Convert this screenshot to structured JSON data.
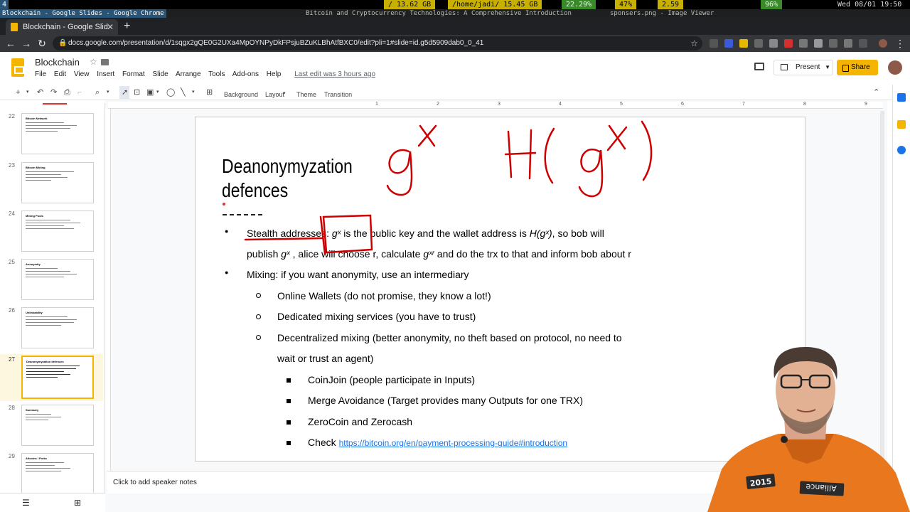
{
  "statusbar": {
    "workspaces": [
      "1",
      "4"
    ],
    "segments": [
      {
        "text": "/ 13.62 GB",
        "style": "yellow"
      },
      {
        "text": "/home/jadi/ 15.45 GB",
        "style": "yellow"
      },
      {
        "text": "22.29%",
        "style": "green"
      },
      {
        "text": "47%",
        "style": "yellow"
      },
      {
        "text": "2.59",
        "style": "yellow"
      },
      {
        "text": "30%",
        "style": "plain"
      },
      {
        "text": "96%",
        "style": "green"
      },
      {
        "text": "Wed 08/01 19:50",
        "style": "plain"
      }
    ]
  },
  "windowbar": {
    "focused": "Blockchain - Google Slides - Google Chrome",
    "other1": "Bitcoin and Cryptocurrency Technologies: A Comprehensive Introduction",
    "other2": "sponsers.png - Image Viewer"
  },
  "browser": {
    "tab_title": "Blockchain - Google Slid",
    "url": "docs.google.com/presentation/d/1sqgx2gQE0G2UXa4MpOYNPyDkFPsjuBZuKLBhAtfBXC0/edit?pli=1#slide=id.g5d5909dab0_0_41",
    "icons": {
      "back": "arrow-left-icon",
      "forward": "arrow-right-icon",
      "reload": "reload-icon",
      "star": "star-icon"
    }
  },
  "app": {
    "title": "Blockchain",
    "menus": [
      "File",
      "Edit",
      "View",
      "Insert",
      "Format",
      "Slide",
      "Arrange",
      "Tools",
      "Add-ons",
      "Help"
    ],
    "last_edit": "Last edit was 3 hours ago",
    "present_label": "Present",
    "share_label": "Share"
  },
  "toolbar": {
    "background_label": "Background",
    "layout_label": "Layout",
    "theme_label": "Theme",
    "transition_label": "Transition"
  },
  "ruler": [
    "1",
    "2",
    "3",
    "4",
    "5",
    "6",
    "7",
    "8",
    "9"
  ],
  "filmstrip": {
    "slides": [
      {
        "num": "22",
        "title": "Bitcoin Network"
      },
      {
        "num": "23",
        "title": "Bitcoin Mining"
      },
      {
        "num": "24",
        "title": "Mining Pools"
      },
      {
        "num": "25",
        "title": "Anonymity"
      },
      {
        "num": "26",
        "title": "Unlinkability"
      },
      {
        "num": "27",
        "title": "Deanonymyzation defences"
      },
      {
        "num": "28",
        "title": "Summary"
      },
      {
        "num": "29",
        "title": "Altcoins / Forks"
      }
    ],
    "selected": "27"
  },
  "slide": {
    "title_line1": "Deanonymyzation",
    "title_line2": "defences",
    "bullet1_part1": "Stealth addresses:",
    "bullet1_gx": "gˣ",
    "bullet1_part2": "is the public key and the wallet address is",
    "bullet1_hgx": "H(gˣ)",
    "bullet1_part3": ", so bob will",
    "bullet1_line2_a": "publish",
    "bullet1_line2_gx": "gˣ",
    "bullet1_line2_b": ", alice will choose r, calculate",
    "bullet1_line2_gxr": "gˣʳ",
    "bullet1_line2_c": "and do the trx to that and inform bob about r",
    "bullet2": "Mixing: if you want anonymity, use an intermediary",
    "sub1": "Online Wallets (do not promise, they know a lot!)",
    "sub2": "Dedicated mixing services (you have to trust)",
    "sub3_line1": "Decentralized mixing (better anonymity, no theft based on protocol, no need to",
    "sub3_line2": "wait or trust an agent)",
    "subsub1": "CoinJoin (people participate in Inputs)",
    "subsub2": "Merge Avoidance (Target provides many Outputs for one TRX)",
    "subsub3": "ZeroCoin and Zerocash",
    "subsub4_prefix": "Check",
    "subsub4_link": "https://bitcoin.org/en/payment-processing-guide#introduction"
  },
  "speaker_notes": "Click to add speaker notes",
  "webcam_shirt_text": "Alliance 2015",
  "colors": {
    "accent": "#f4b400",
    "ink": "#cc0000",
    "link": "#1a73e8"
  }
}
